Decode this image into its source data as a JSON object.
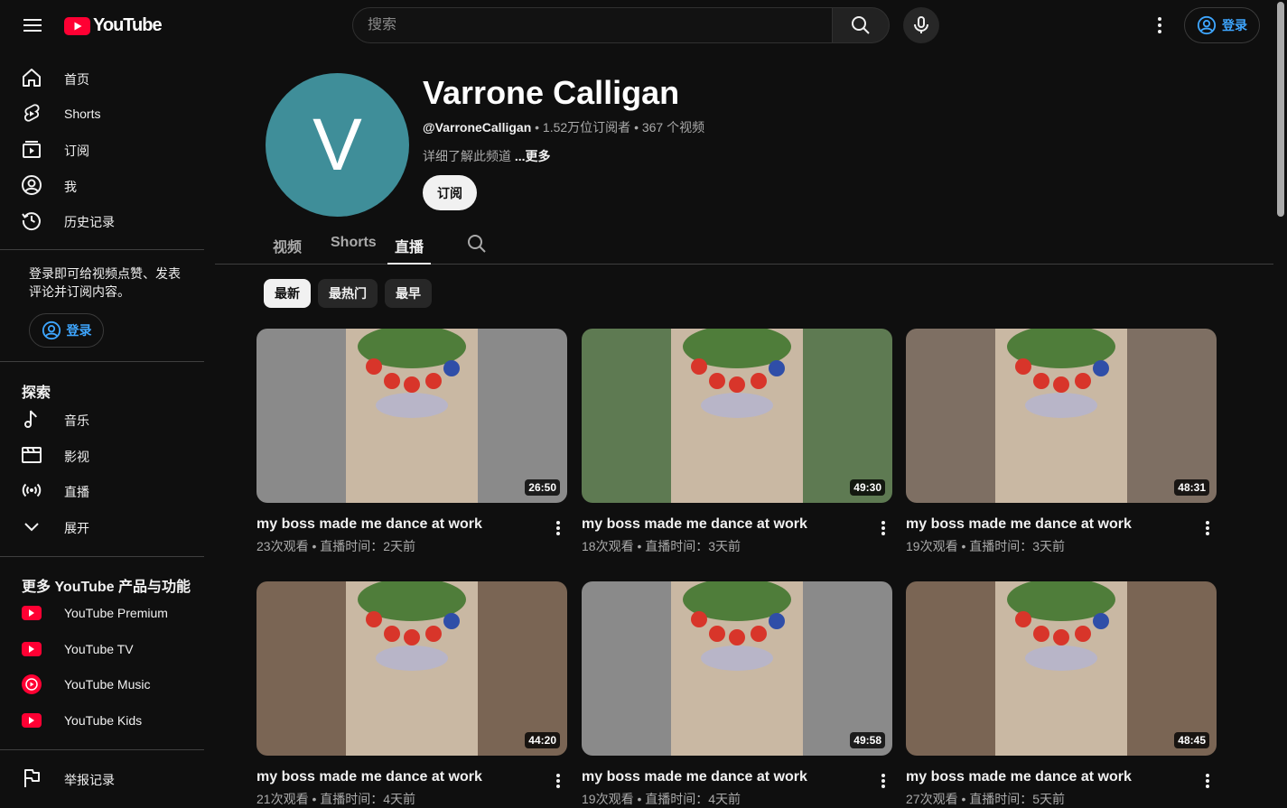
{
  "header": {
    "logo_text": "YouTube",
    "search_placeholder": "搜索",
    "signin_label": "登录"
  },
  "sidebar": {
    "main": [
      {
        "label": "首页",
        "icon": "home-icon"
      },
      {
        "label": "Shorts",
        "icon": "shorts-icon"
      },
      {
        "label": "订阅",
        "icon": "subscriptions-icon"
      },
      {
        "label": "我",
        "icon": "you-icon"
      },
      {
        "label": "历史记录",
        "icon": "history-icon"
      }
    ],
    "signin_prompt": "登录即可给视频点赞、发表评论并订阅内容。",
    "signin_label": "登录",
    "explore_title": "探索",
    "explore": [
      {
        "label": "音乐",
        "icon": "music-icon"
      },
      {
        "label": "影视",
        "icon": "movies-icon"
      },
      {
        "label": "直播",
        "icon": "live-icon"
      },
      {
        "label": "展开",
        "icon": "chevron-down-icon"
      }
    ],
    "more_title": "更多 YouTube 产品与功能",
    "more": [
      {
        "label": "YouTube Premium",
        "icon": "youtube-premium-icon"
      },
      {
        "label": "YouTube TV",
        "icon": "youtube-tv-icon"
      },
      {
        "label": "YouTube Music",
        "icon": "youtube-music-icon"
      },
      {
        "label": "YouTube Kids",
        "icon": "youtube-kids-icon"
      }
    ],
    "report_label": "举报记录"
  },
  "channel": {
    "avatar_letter": "V",
    "avatar_color": "#3f8e99",
    "name": "Varrone Calligan",
    "handle": "@VarroneCalligan",
    "stats": " • 1.52万位订阅者 • 367 个视频",
    "description": "详细了解此频道 ",
    "more_label": "...更多",
    "subscribe_label": "订阅"
  },
  "tabs": [
    {
      "label": "视频",
      "active": false
    },
    {
      "label": "Shorts",
      "active": false
    },
    {
      "label": "直播",
      "active": true
    }
  ],
  "chips": [
    {
      "label": "最新",
      "active": true
    },
    {
      "label": "最热门",
      "active": false
    },
    {
      "label": "最早",
      "active": false
    }
  ],
  "videos": [
    {
      "title": "my boss made me dance at work",
      "meta": "23次观看 • 直播时间：2天前",
      "duration": "26:50",
      "bg": "#8a8a8a"
    },
    {
      "title": "my boss made me dance at work",
      "meta": "18次观看 • 直播时间：3天前",
      "duration": "49:30",
      "bg": "#5e7a52"
    },
    {
      "title": "my boss made me dance at work",
      "meta": "19次观看 • 直播时间：3天前",
      "duration": "48:31",
      "bg": "#7e6f63"
    },
    {
      "title": "my boss made me dance at work",
      "meta": "21次观看 • 直播时间：4天前",
      "duration": "44:20",
      "bg": "#7a6554"
    },
    {
      "title": "my boss made me dance at work",
      "meta": "19次观看 • 直播时间：4天前",
      "duration": "49:58",
      "bg": "#8a8a8a"
    },
    {
      "title": "my boss made me dance at work",
      "meta": "27次观看 • 直播时间：5天前",
      "duration": "48:45",
      "bg": "#7a6554"
    }
  ]
}
